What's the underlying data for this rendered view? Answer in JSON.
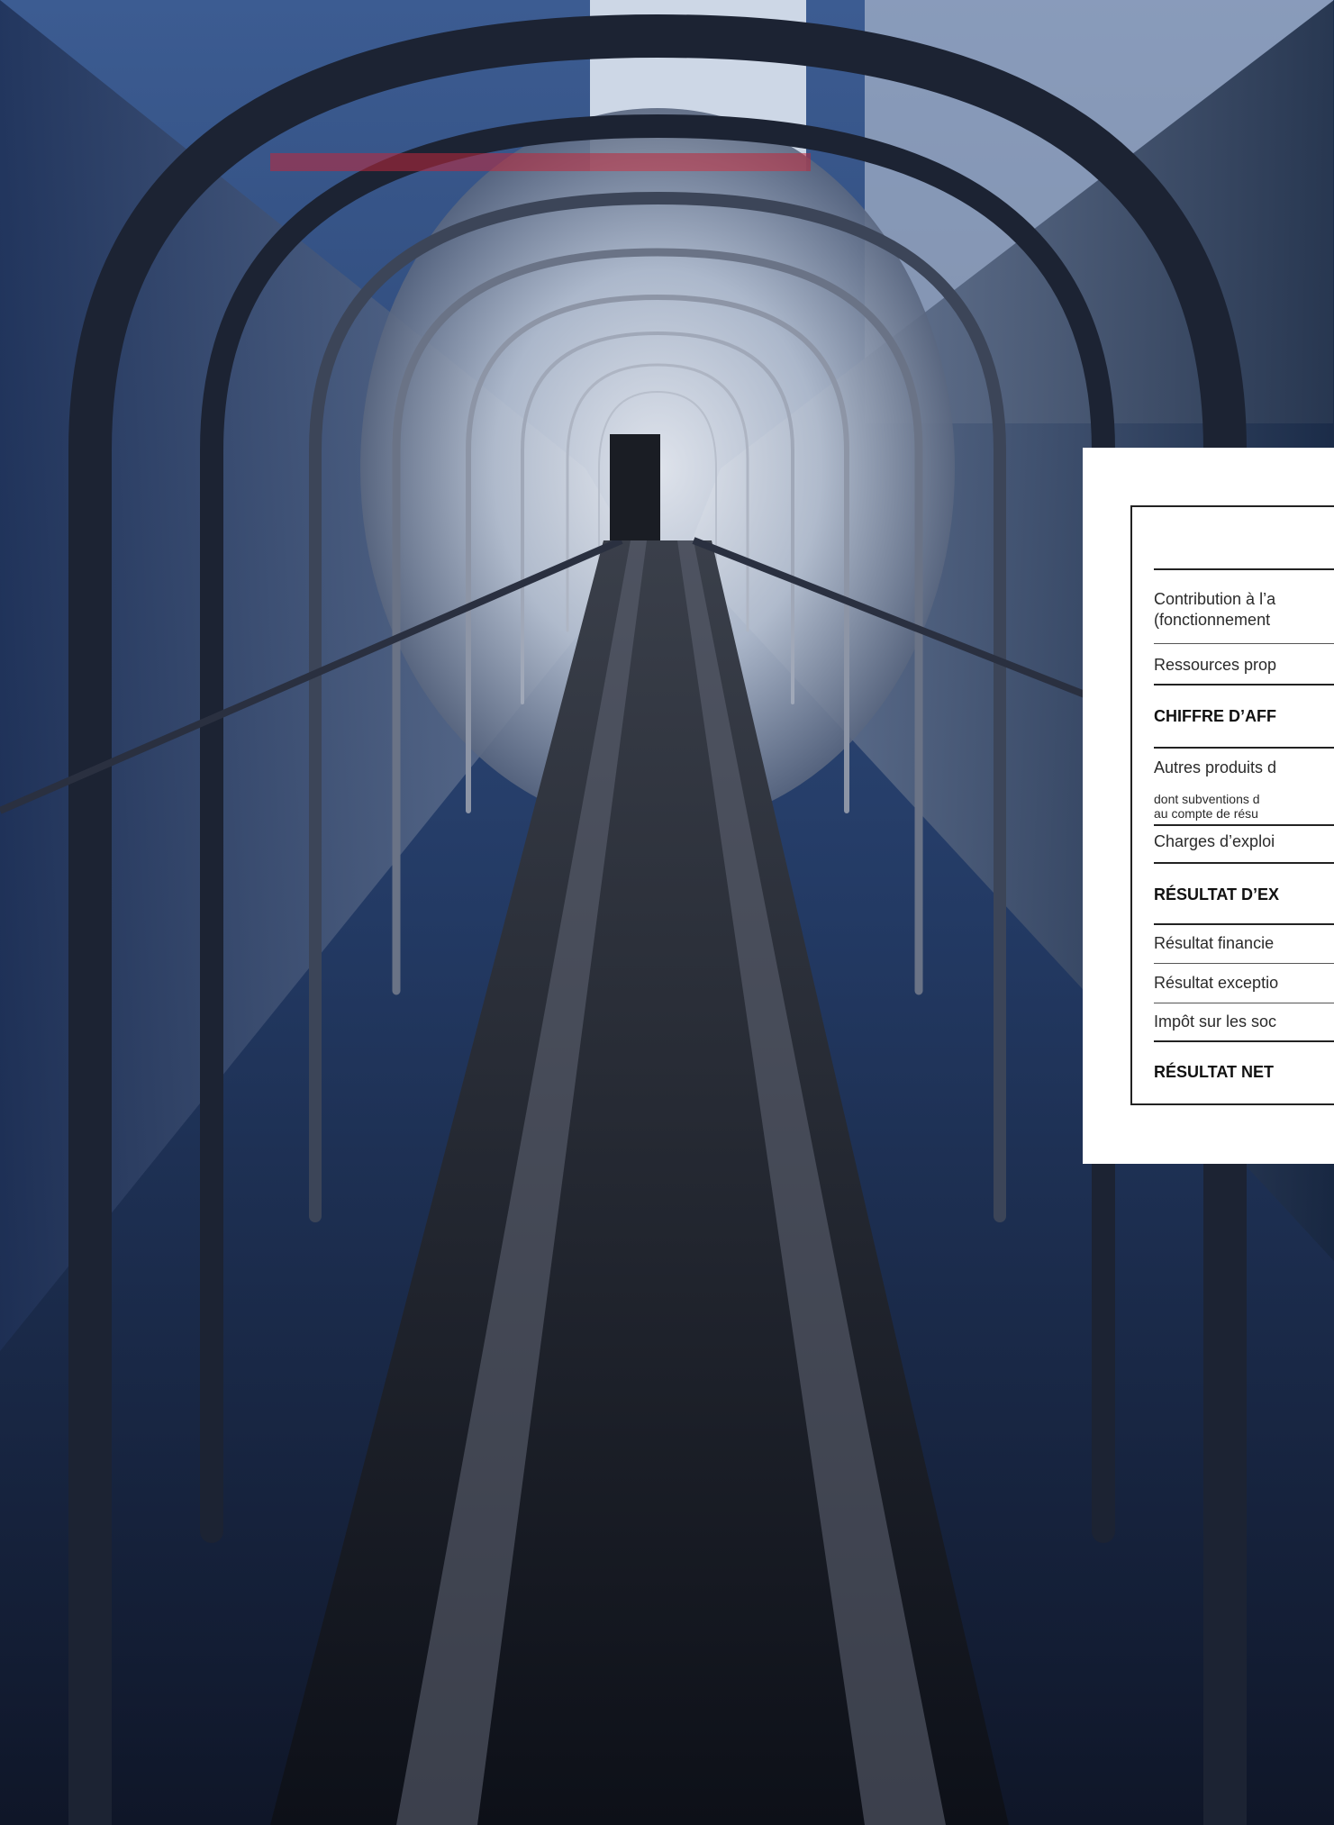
{
  "table": {
    "rows": [
      {
        "line1": "Contribution à l’a",
        "line2": "(fonctionnement"
      },
      {
        "label": "Ressources prop"
      },
      {
        "label": "CHIFFRE D’AFF"
      },
      {
        "label": "Autres produits d"
      },
      {
        "line1": "dont subventions d",
        "line2": "au compte de résu"
      },
      {
        "label": "Charges d’exploi"
      },
      {
        "label": "RÉSULTAT D’EX"
      },
      {
        "label": "Résultat financie"
      },
      {
        "label": "Résultat exceptio"
      },
      {
        "label": "Impôt sur les soc"
      },
      {
        "label": "RÉSULTAT NET"
      }
    ]
  }
}
